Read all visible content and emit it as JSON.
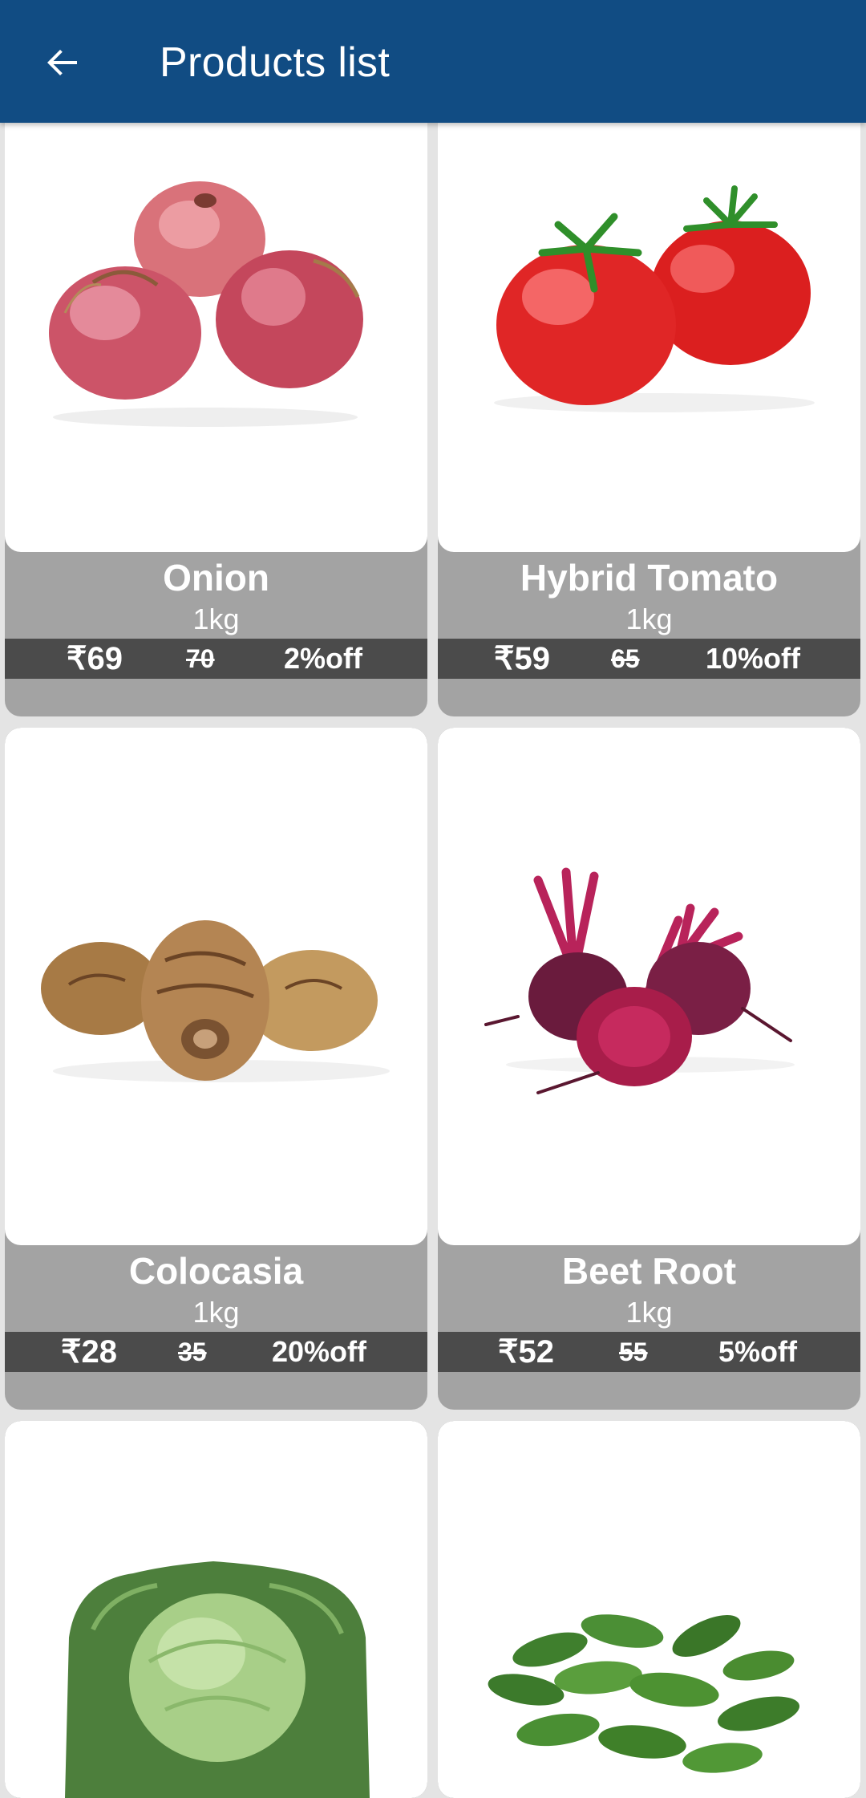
{
  "appbar": {
    "title": "Products list",
    "back_icon": "arrow-left-icon",
    "background": "#114c83"
  },
  "colors": {
    "card_info_bg": "#a3a3a3",
    "price_bar_bg": "#4b4b4b",
    "page_bg": "#e4e4e4"
  },
  "products": [
    {
      "name": "Onion",
      "unit": "1kg",
      "price": "₹69",
      "mrp": "70",
      "discount": "2%off",
      "image": "onion-image"
    },
    {
      "name": "Hybrid Tomato",
      "unit": "1kg",
      "price": "₹59",
      "mrp": "65",
      "discount": "10%off",
      "image": "tomato-image"
    },
    {
      "name": "Colocasia",
      "unit": "1kg",
      "price": "₹28",
      "mrp": "35",
      "discount": "20%off",
      "image": "colocasia-image"
    },
    {
      "name": "Beet Root",
      "unit": "1kg",
      "price": "₹52",
      "mrp": "55",
      "discount": "5%off",
      "image": "beetroot-image"
    },
    {
      "image": "cabbage-image"
    },
    {
      "image": "cucumber-image"
    }
  ]
}
